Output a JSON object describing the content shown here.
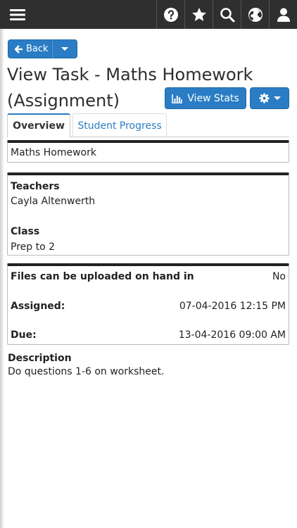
{
  "nav": {
    "menu_icon": "hamburger-icon",
    "icons": [
      "help-icon",
      "star-icon",
      "search-icon",
      "globe-icon",
      "user-icon"
    ]
  },
  "toolbar": {
    "back_label": "Back"
  },
  "page": {
    "title": "View Task - Maths Homework (Assignment)",
    "view_stats_label": "View Stats"
  },
  "tabs": [
    {
      "label": "Overview",
      "active": true
    },
    {
      "label": "Student Progress",
      "active": false
    }
  ],
  "task": {
    "name": "Maths Homework",
    "teachers_label": "Teachers",
    "teachers_value": "Cayla Altenwerth",
    "class_label": "Class",
    "class_value": "Prep to 2",
    "upload_label": "Files can be uploaded on hand in",
    "upload_value": "No",
    "assigned_label": "Assigned:",
    "assigned_value": "07-04-2016 12:15 PM",
    "due_label": "Due:",
    "due_value": "13-04-2016 09:00 AM",
    "description_label": "Description",
    "description_value": "Do questions 1-6 on worksheet."
  },
  "colors": {
    "accent": "#2a7dc4",
    "topbar": "#2f2f2f"
  }
}
